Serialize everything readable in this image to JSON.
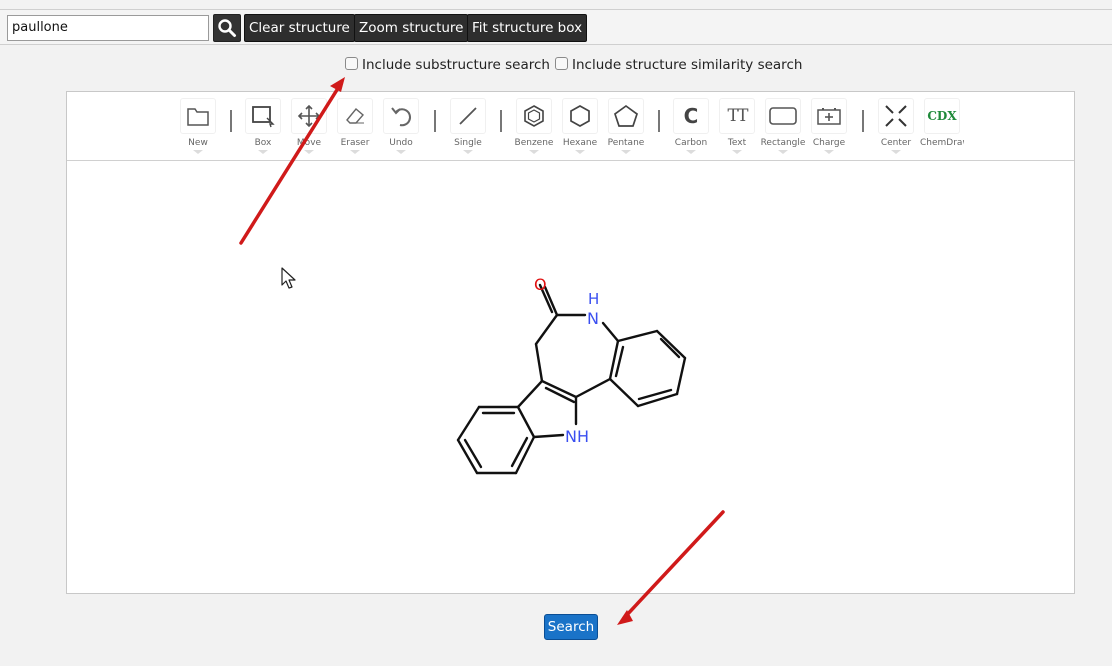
{
  "header": {
    "search_value": "paullone",
    "clear_label": "Clear structure",
    "zoom_label": "Zoom structure",
    "fit_label": "Fit structure box"
  },
  "options": {
    "substructure_label": "Include substructure search",
    "substructure_checked": false,
    "similarity_label": "Include structure similarity search",
    "similarity_checked": false
  },
  "toolbar": {
    "tools": [
      {
        "label": "New",
        "icon": "folder-icon"
      },
      {
        "label": "Box",
        "icon": "select-box-icon"
      },
      {
        "label": "Move",
        "icon": "move-icon"
      },
      {
        "label": "Eraser",
        "icon": "eraser-icon"
      },
      {
        "label": "Undo",
        "icon": "undo-icon"
      },
      {
        "label": "Single",
        "icon": "single-bond-icon"
      },
      {
        "label": "Benzene",
        "icon": "benzene-icon"
      },
      {
        "label": "Hexane",
        "icon": "hexane-icon"
      },
      {
        "label": "Pentane",
        "icon": "pentane-icon"
      },
      {
        "label": "Carbon",
        "icon": "carbon-icon"
      },
      {
        "label": "Text",
        "icon": "text-icon"
      },
      {
        "label": "Rectangle",
        "icon": "rectangle-icon"
      },
      {
        "label": "Charge",
        "icon": "charge-icon"
      },
      {
        "label": "Center",
        "icon": "center-icon"
      },
      {
        "label": "ChemDraw",
        "icon": "cdx-icon"
      }
    ],
    "carbon_glyph": "C",
    "text_glyph": "TT",
    "cdx_glyph": "CDX"
  },
  "molecule": {
    "oxygen_label": "O",
    "amide_h_label": "H",
    "amide_n_label": "N",
    "indole_nh_label": "NH",
    "colors": {
      "oxygen": "#e01010",
      "nitrogen": "#3a4ff0",
      "bond": "#111111"
    }
  },
  "footer": {
    "search_label": "Search"
  },
  "colors": {
    "accent": "#1a73c8",
    "arrow": "#d01a1a",
    "dark_button": "#2e2e2e",
    "cdx_green": "#1f8a3a"
  }
}
